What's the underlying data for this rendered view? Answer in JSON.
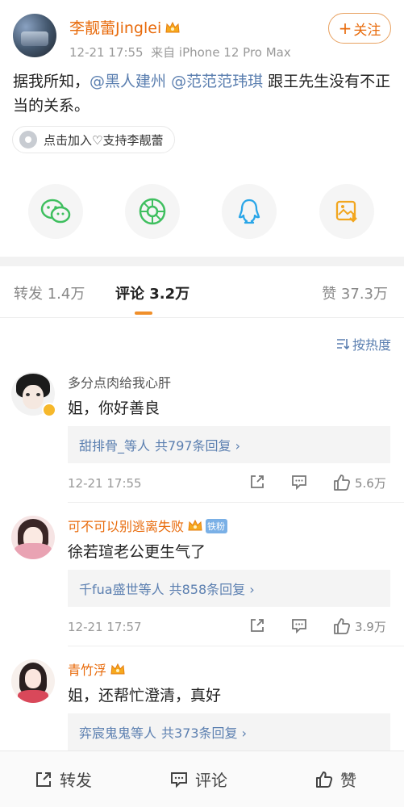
{
  "post": {
    "author": "李靓蕾Jinglei",
    "time": "12-21 17:55",
    "source": "来自 iPhone 12 Pro Max",
    "follow_label": "关注",
    "text_prefix": "据我所知，",
    "mention1": "@黑人建州",
    "mention2": "@范范范玮琪",
    "text_suffix": " 跟王先生没有不正当的关系。",
    "support_chip": "点击加入♡支持李靓蕾",
    "share_icons": [
      "wechat-icon",
      "moments-icon",
      "qq-icon",
      "save-image-icon"
    ]
  },
  "tabs": {
    "repost": "转发 1.4万",
    "comment": "评论 3.2万",
    "like": "赞 37.3万"
  },
  "sort_label": "按热度",
  "comments": [
    {
      "name": "多分点肉给我心肝",
      "name_color": "#555555",
      "text": "姐，你好善良",
      "reply_users": "甜排骨_等人",
      "reply_count": "共797条回复 ›",
      "time": "12-21 17:55",
      "likes": "5.6万"
    },
    {
      "name": "可不可以别逃离失败",
      "name_color": "#e86b0c",
      "badge": "铁粉",
      "text": "徐若瑄老公更生气了",
      "reply_users": "千fua盛世等人",
      "reply_count": "共858条回复 ›",
      "time": "12-21 17:57",
      "likes": "3.9万"
    },
    {
      "name": "青竹浮",
      "name_color": "#e86b0c",
      "text": "姐，还帮忙澄清，真好",
      "reply_users": "弈宸鬼鬼等人",
      "reply_count": "共373条回复 ›"
    }
  ],
  "bottom_bar": {
    "repost": "转发",
    "comment": "评论",
    "like": "赞"
  },
  "colors": {
    "accent_orange": "#e86b0c",
    "link_blue": "#5b7fb0",
    "tab_underline": "#f08f2a"
  }
}
